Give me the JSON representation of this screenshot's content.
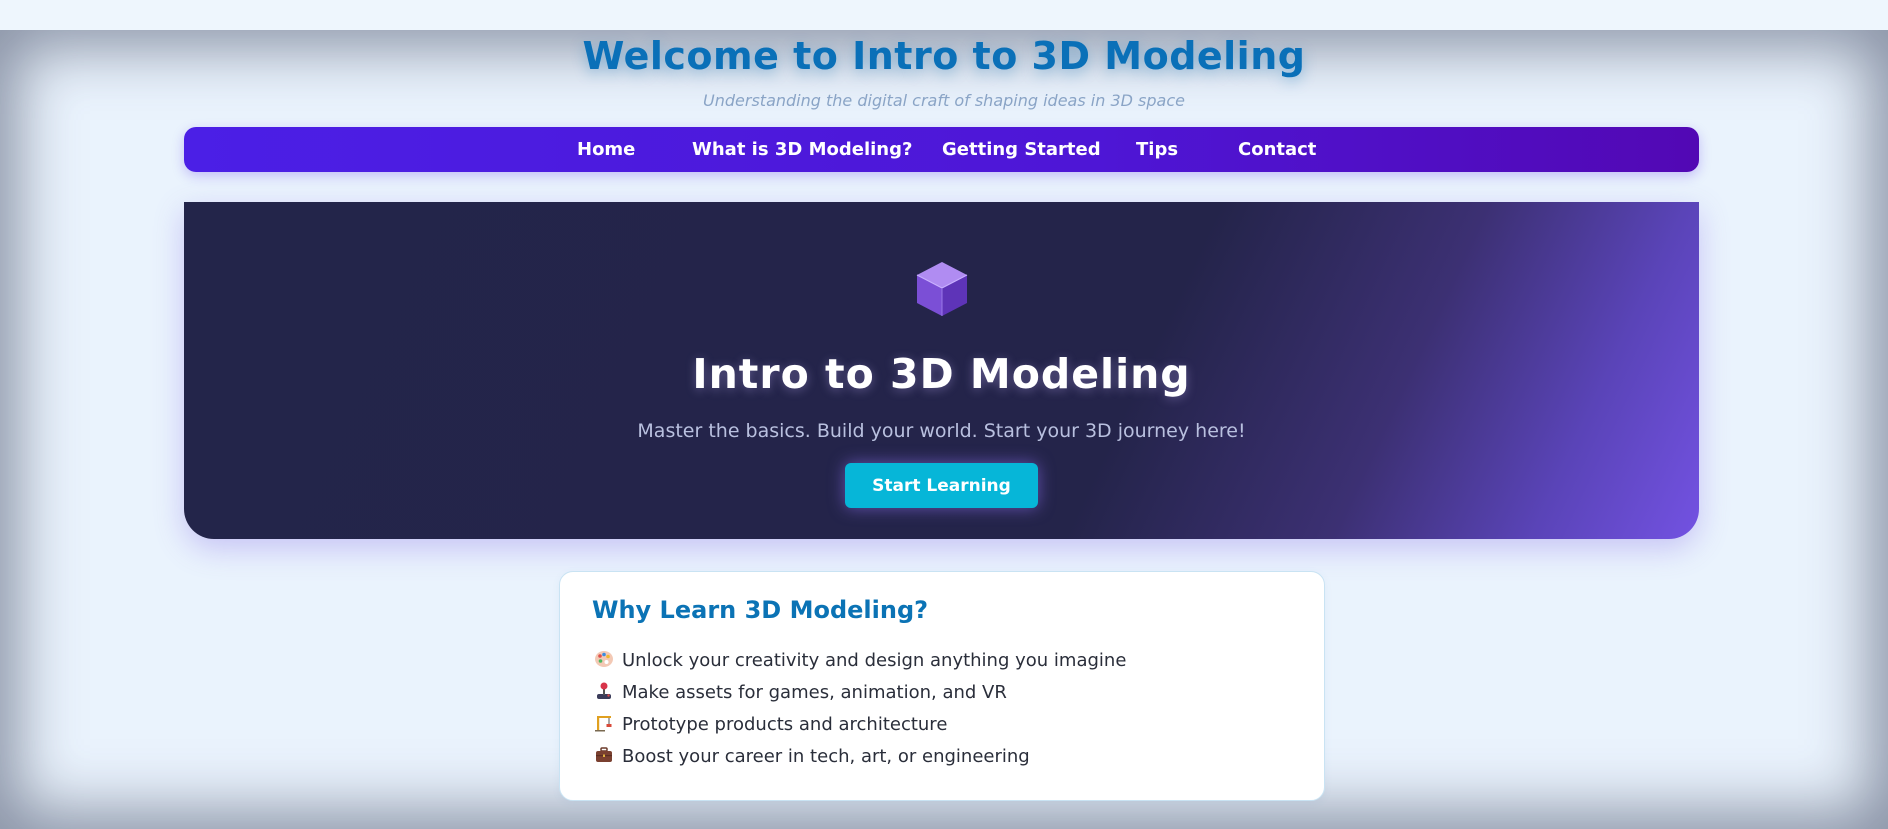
{
  "header": {
    "title": "Welcome to Intro to 3D Modeling",
    "subtitle": "Understanding the digital craft of shaping ideas in 3D space"
  },
  "nav": {
    "items": [
      {
        "label": "Home"
      },
      {
        "label": "What is 3D Modeling?"
      },
      {
        "label": "Getting Started"
      },
      {
        "label": "Tips"
      },
      {
        "label": "Contact"
      }
    ]
  },
  "hero": {
    "icon": "cube-icon",
    "title": "Intro to 3D Modeling",
    "tagline": "Master the basics. Build your world. Start your 3D journey here!",
    "cta_label": "Start Learning"
  },
  "why": {
    "title": "Why Learn 3D Modeling?",
    "items": [
      {
        "icon": "palette-icon",
        "text": "Unlock your creativity and design anything you imagine"
      },
      {
        "icon": "joystick-icon",
        "text": "Make assets for games, animation, and VR"
      },
      {
        "icon": "crane-icon",
        "text": "Prototype products and architecture"
      },
      {
        "icon": "briefcase-icon",
        "text": "Boost your career in tech, art, or engineering"
      }
    ]
  },
  "colors": {
    "title": "#0a70b8",
    "nav_start": "#4b1fe6",
    "nav_end": "#5208b4",
    "hero_dark": "#23254a",
    "hero_accent": "#7352e2",
    "cta": "#06b6d8"
  }
}
